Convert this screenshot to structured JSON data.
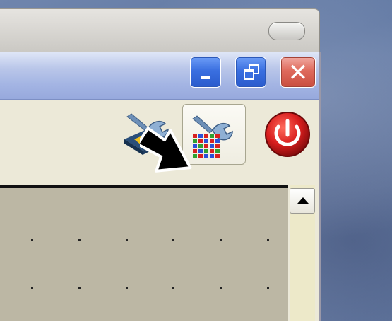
{
  "desktop": {
    "background_color": "#6f85ad"
  },
  "back_window": {
    "restore_pill_icon": "pill-button-icon"
  },
  "titlebar": {
    "buttons": [
      {
        "name": "minimize",
        "icon": "minimize-icon",
        "color": "#3a6fe0"
      },
      {
        "name": "restore",
        "icon": "restore-icon",
        "color": "#3a6fe0"
      },
      {
        "name": "close",
        "icon": "close-icon",
        "glyph": "✕",
        "color": "#df6a5c"
      }
    ]
  },
  "toolbar": {
    "tools": [
      {
        "name": "wrench-board-tool",
        "icon": "wrench-board-icon"
      },
      {
        "name": "wrench-grid-tool",
        "icon": "wrench-grid-icon",
        "selected": true
      },
      {
        "name": "power-tool",
        "icon": "power-icon",
        "color": "#d81e1e"
      }
    ],
    "pointer_arrow_icon": "arrow-pointer-icon"
  },
  "canvas": {
    "background": "#bcb7a4"
  },
  "scrollbar": {
    "up_icon": "scroll-up-arrow-icon"
  }
}
